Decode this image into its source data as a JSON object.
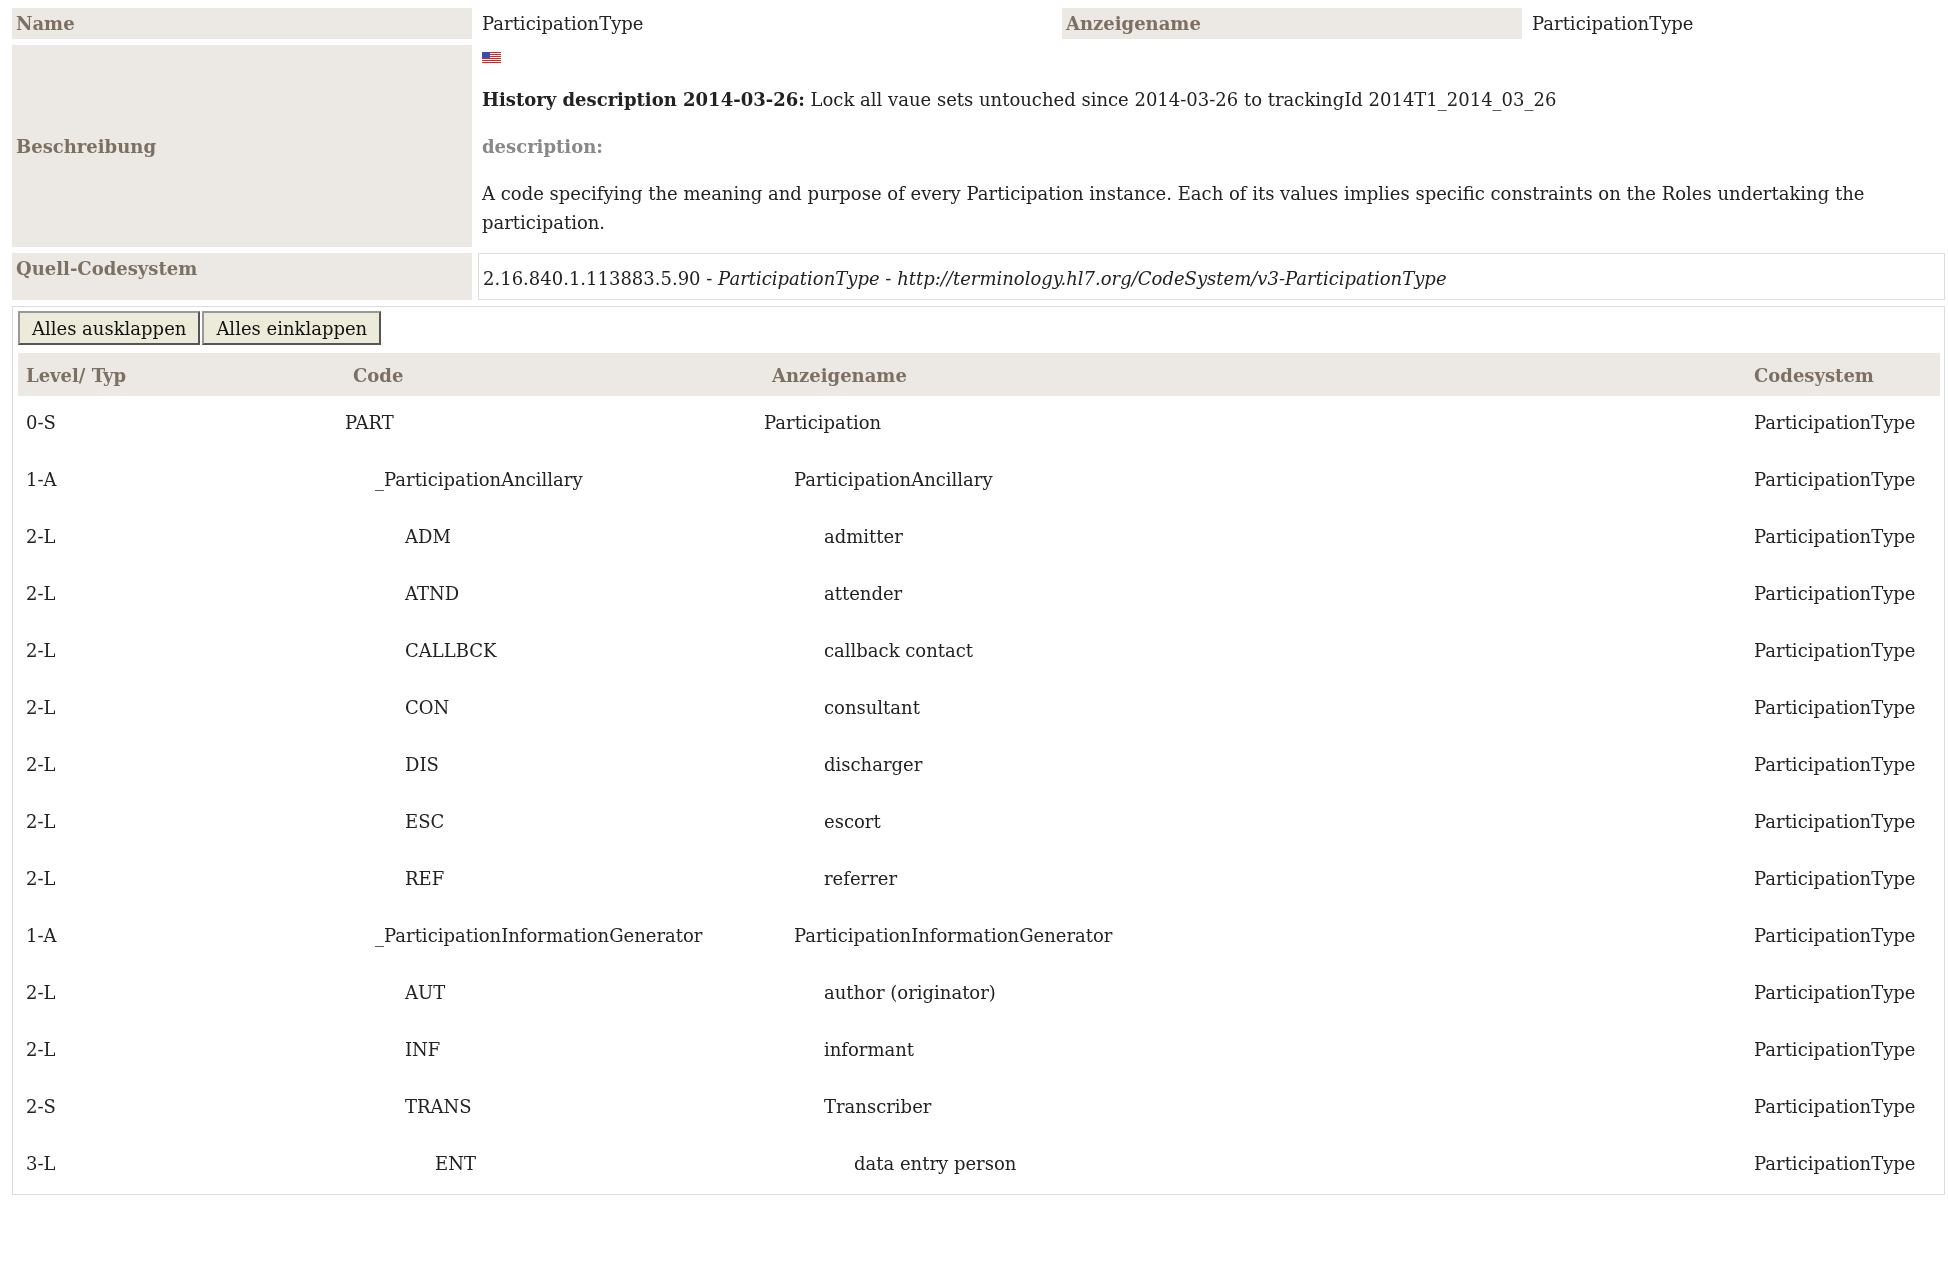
{
  "summary": {
    "name_label": "Name",
    "name_value": "ParticipationType",
    "display_label": "Anzeigename",
    "display_value": "ParticipationType",
    "description_label": "Beschreibung",
    "history": "**History description 2014-03-26:** Lock all vaue sets untouched since 2014-03-26 to trackingId 2014T1_2014_03_26",
    "description_heading": "description:",
    "description_text": "A code specifying the meaning and purpose of every Participation instance. Each of its values implies specific constraints on the Roles undertaking the participation.",
    "source_label": "Quell-Codesystem",
    "source_value": "2.16.840.1.113883.5.90 - *ParticipationType* - *http://terminology.hl7.org/CodeSystem/v3-ParticipationType*"
  },
  "buttons": [
    "Alles ausklappen",
    "Alles einklappen"
  ],
  "table": {
    "columns": [
      "Level/ Typ",
      "Code",
      "Anzeigename",
      "Codesystem"
    ],
    "rows": [
      {
        "level": "0-S",
        "code": "PART",
        "display": "Participation",
        "system": "ParticipationType",
        "children": [
          {
            "level": "1-A",
            "code": "_ParticipationAncillary",
            "display": "ParticipationAncillary",
            "system": "ParticipationType",
            "children": [
              {
                "level": "2-L",
                "code": "ADM",
                "display": "admitter",
                "system": "ParticipationType"
              },
              {
                "level": "2-L",
                "code": "ATND",
                "display": "attender",
                "system": "ParticipationType"
              },
              {
                "level": "2-L",
                "code": "CALLBCK",
                "display": "callback contact",
                "system": "ParticipationType"
              },
              {
                "level": "2-L",
                "code": "CON",
                "display": "consultant",
                "system": "ParticipationType"
              },
              {
                "level": "2-L",
                "code": "DIS",
                "display": "discharger",
                "system": "ParticipationType"
              },
              {
                "level": "2-L",
                "code": "ESC",
                "display": "escort",
                "system": "ParticipationType"
              },
              {
                "level": "2-L",
                "code": "REF",
                "display": "referrer",
                "system": "ParticipationType"
              }
            ]
          },
          {
            "level": "1-A",
            "code": "_ParticipationInformationGenerator",
            "display": "ParticipationInformationGenerator",
            "system": "ParticipationType",
            "children": [
              {
                "level": "2-L",
                "code": "AUT",
                "display": "author (originator)",
                "system": "ParticipationType"
              },
              {
                "level": "2-L",
                "code": "INF",
                "display": "informant",
                "system": "ParticipationType"
              },
              {
                "level": "2-S",
                "code": "TRANS",
                "display": "Transcriber",
                "system": "ParticipationType",
                "children": [
                  {
                    "level": "3-L",
                    "code": "ENT",
                    "display": "data entry person",
                    "system": "ParticipationType"
                  }
                ]
              }
            ]
          }
        ]
      }
    ]
  }
}
